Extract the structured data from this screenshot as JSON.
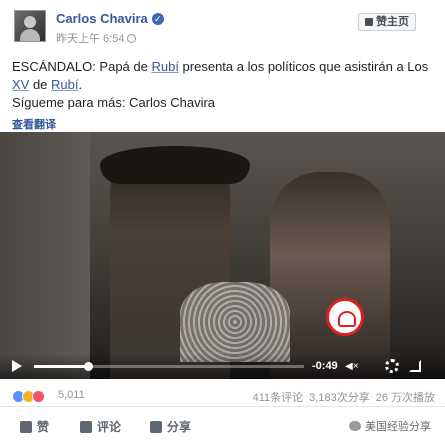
{
  "post": {
    "author": "Carlos Chavira",
    "time": "昨天上午 6:54",
    "like_page_label": "赞主页",
    "text_line1_before": "ESCÁNDALO: Papá de ",
    "text_link1": "Rubí",
    "text_line1_after": " presenta a los políticos que asistirán a Los ",
    "text_link2": "XV",
    "text_mid": " de ",
    "text_link3": "Rubí",
    "text_end": ".",
    "follow_line": "Sígueme para más: Carlos Chavira",
    "see_translation": "查看翻译"
  },
  "video": {
    "timer": "-0:49",
    "progress_fraction": 0.2
  },
  "stats": {
    "reaction_count": "5,011",
    "comments": "411条评论",
    "shares": "3,183次分享",
    "views": "26 万次播放"
  },
  "actions": {
    "like": "赞",
    "comment": "评论",
    "share": "分享"
  },
  "watermark": "美国经验分享"
}
